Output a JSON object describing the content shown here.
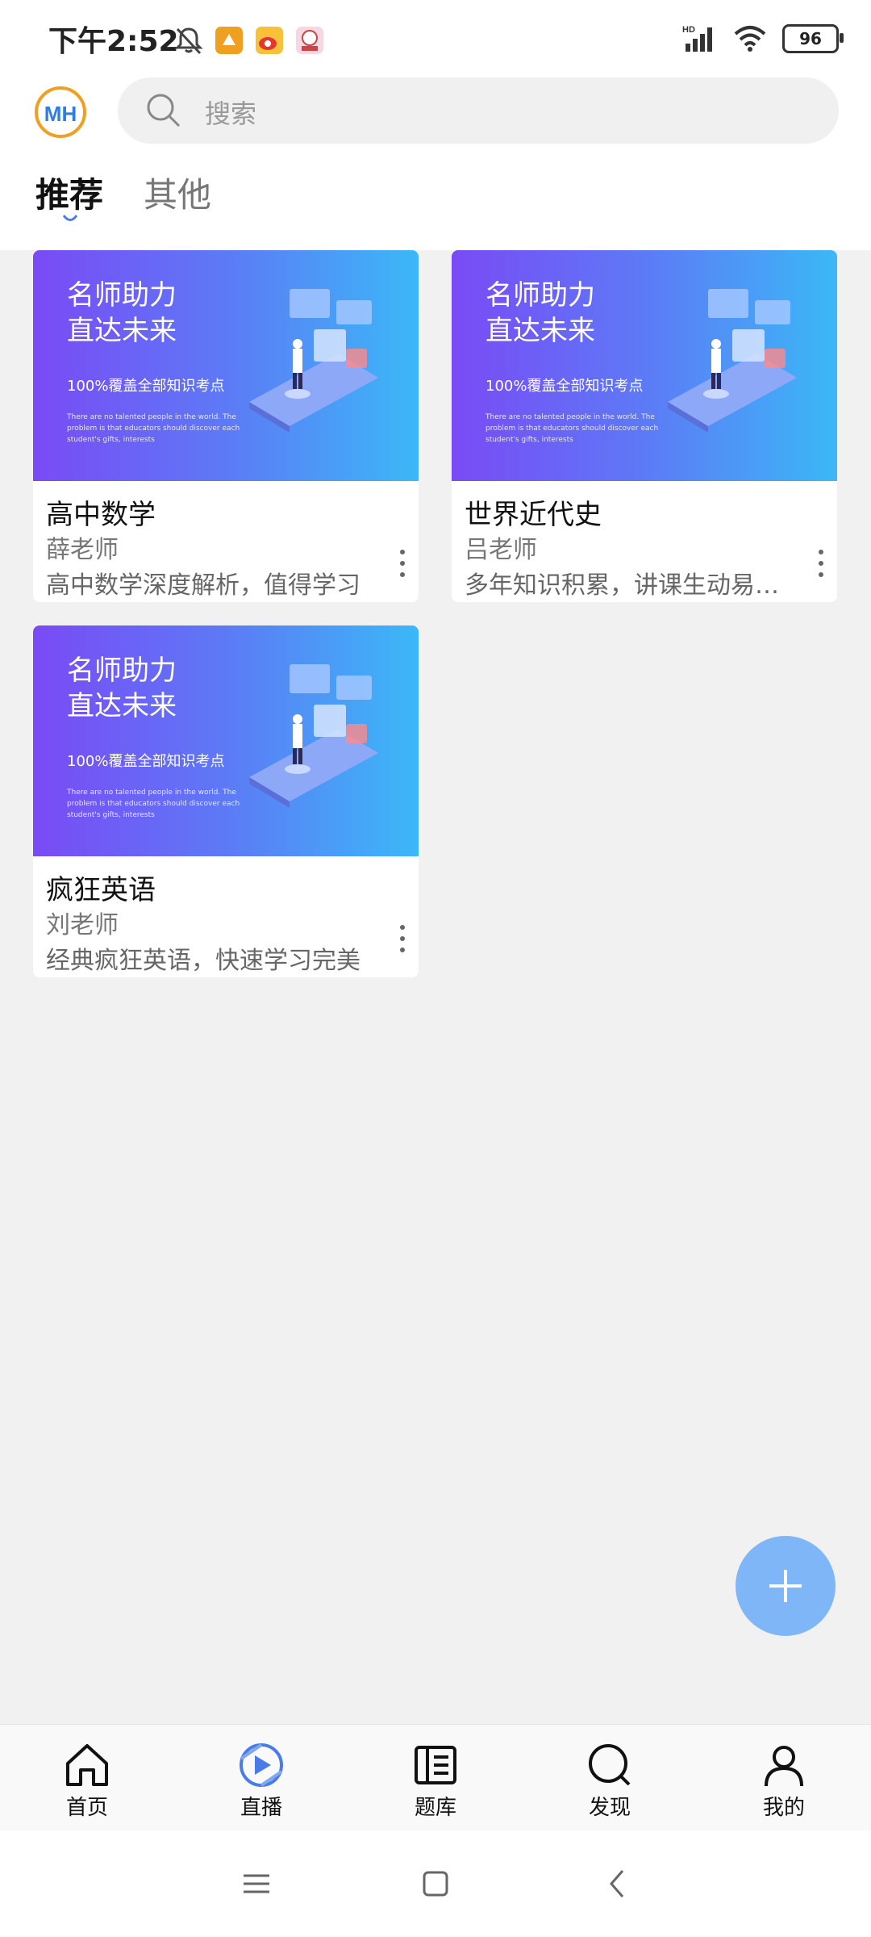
{
  "status_bar": {
    "time": "下午2:52",
    "battery": "96",
    "network": "HD"
  },
  "header": {
    "search_placeholder": "搜索",
    "tabs": [
      {
        "label": "推荐",
        "active": true
      },
      {
        "label": "其他",
        "active": false
      }
    ]
  },
  "banner": {
    "headline_line1": "名师助力",
    "headline_line2": "直达未来",
    "subline": "100%覆盖全部知识考点",
    "fine_print": "There are no talented people in the world. The problem is that educators should discover each student's gifts, interests"
  },
  "courses": [
    {
      "title": "高中数学",
      "teacher": "薛老师",
      "description": "高中数学深度解析，值得学习"
    },
    {
      "title": "世界近代史",
      "teacher": "吕老师",
      "description": "多年知识积累，讲课生动易于理解"
    },
    {
      "title": "疯狂英语",
      "teacher": "刘老师",
      "description": "经典疯狂英语，快速学习完美"
    }
  ],
  "bottom_nav": [
    {
      "label": "首页",
      "icon": "home-icon"
    },
    {
      "label": "直播",
      "icon": "live-icon",
      "active": true
    },
    {
      "label": "题库",
      "icon": "question-bank-icon"
    },
    {
      "label": "发现",
      "icon": "discover-icon"
    },
    {
      "label": "我的",
      "icon": "profile-icon"
    }
  ],
  "colors": {
    "accent": "#4a7ce8",
    "fab": "#7fb6f8",
    "banner_start": "#7a4af5",
    "banner_end": "#3bb8f7"
  }
}
